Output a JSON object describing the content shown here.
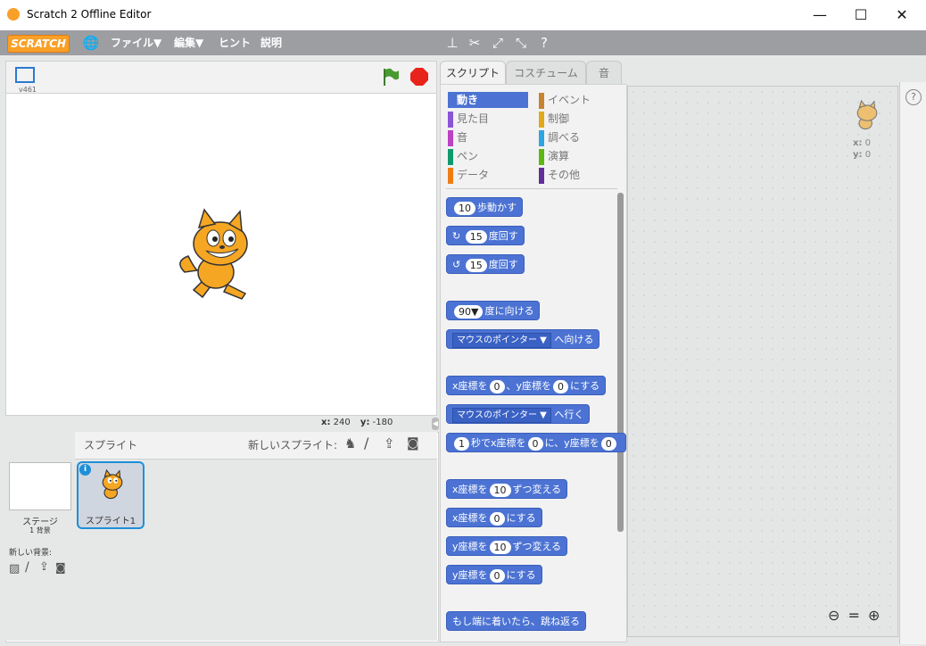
{
  "window": {
    "title": "Scratch 2 Offline Editor",
    "minimize": "—",
    "maximize": "☐",
    "close": "✕"
  },
  "menu": {
    "logo": "SCRATCH",
    "file": "ファイル▼",
    "edit": "編集▼",
    "hint": "ヒント",
    "about": "説明"
  },
  "stage": {
    "version": "v461",
    "coords_x_label": "x:",
    "coords_x": "240",
    "coords_y_label": "y:",
    "coords_y": "-180"
  },
  "tabs": {
    "scripts": "スクリプト",
    "costumes": "コスチューム",
    "sounds": "音"
  },
  "categories": {
    "motion": "動き",
    "looks": "見た目",
    "sound": "音",
    "pen": "ペン",
    "data": "データ",
    "events": "イベント",
    "control": "制御",
    "sensing": "調べる",
    "operators": "演算",
    "more": "その他"
  },
  "blocks": {
    "move_num": "10",
    "move_text": "歩動かす",
    "turn_right_num": "15",
    "turn_right_text": "度回す",
    "turn_left_num": "15",
    "turn_left_text": "度回す",
    "point_dir_num": "90▼",
    "point_dir_text": "度に向ける",
    "point_toward_dd": "マウスのポインター ▼",
    "point_toward_text": "へ向ける",
    "goto_xy_a": "x座標を",
    "goto_xy_x": "0",
    "goto_xy_b": "、y座標を",
    "goto_xy_y": "0",
    "goto_xy_c": "にする",
    "goto_dd": "マウスのポインター ▼",
    "goto_text": "へ行く",
    "glide_num": "1",
    "glide_a": "秒でx座標を",
    "glide_x": "0",
    "glide_b": "に、y座標を",
    "glide_y": "0",
    "change_x_a": "x座標を",
    "change_x_num": "10",
    "change_x_b": "ずつ変える",
    "set_x_a": "x座標を",
    "set_x_num": "0",
    "set_x_b": "にする",
    "change_y_a": "y座標を",
    "change_y_num": "10",
    "change_y_b": "ずつ変える",
    "set_y_a": "y座標を",
    "set_y_num": "0",
    "set_y_b": "にする",
    "bounce": "もし端に着いたら、跳ね返る"
  },
  "sprites": {
    "header": "スプライト",
    "new_sprite": "新しいスプライト:",
    "stage_label": "ステージ",
    "stage_bg": "1 背景",
    "new_bg": "新しい背景:",
    "sprite1": "スプライト1"
  },
  "scripts_area": {
    "x_label": "x:",
    "x_val": "0",
    "y_label": "y:",
    "y_val": "0"
  }
}
